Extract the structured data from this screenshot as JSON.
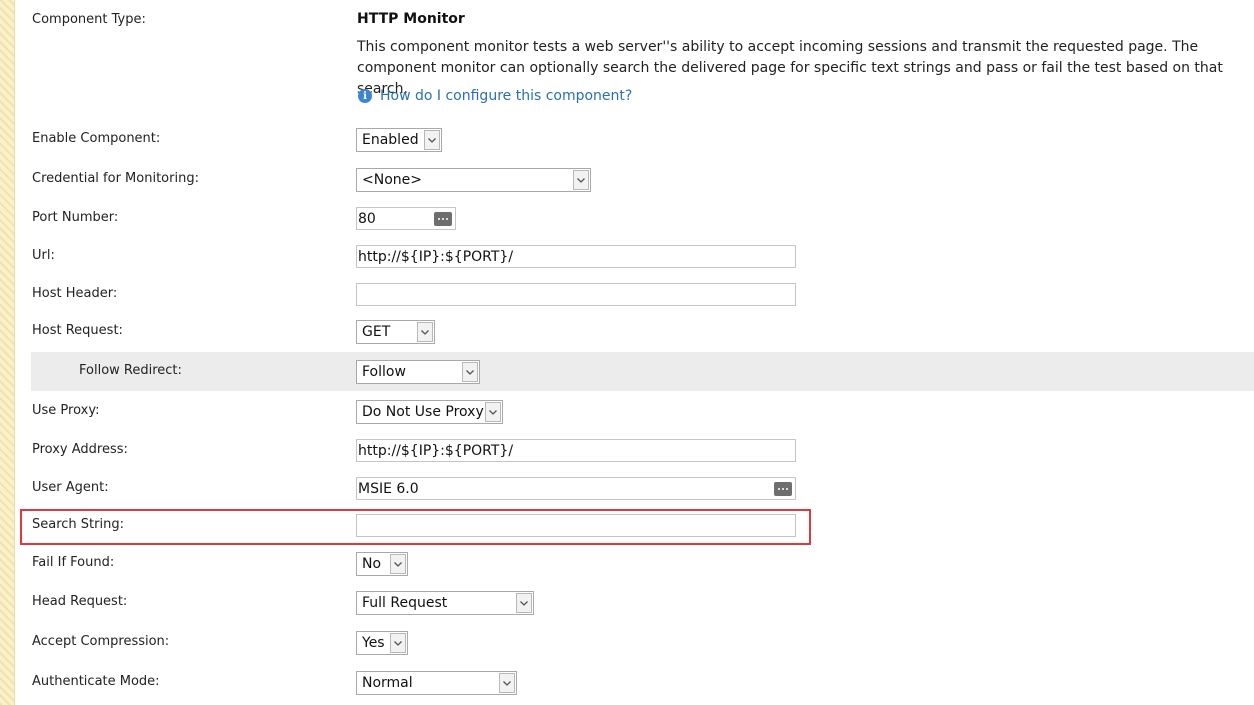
{
  "component": {
    "type_label": "Component Type:",
    "name": "HTTP Monitor",
    "description": "This component monitor tests a web server''s ability to accept incoming sessions and transmit the requested page. The component monitor can optionally search the delivered page for specific text strings and pass or fail the test based on that search.",
    "help_link": "How do I configure this component?",
    "help_icon": "info-icon"
  },
  "fields": {
    "enable_component": {
      "label": "Enable Component:",
      "value": "Enabled"
    },
    "credential": {
      "label": "Credential for Monitoring:",
      "value": "<None>"
    },
    "port": {
      "label": "Port Number:",
      "value": "80"
    },
    "url": {
      "label": "Url:",
      "value": "http://${IP}:${PORT}/"
    },
    "host_header": {
      "label": "Host Header:",
      "value": ""
    },
    "host_request": {
      "label": "Host Request:",
      "value": "GET"
    },
    "follow_redirect": {
      "label": "Follow Redirect:",
      "value": "Follow"
    },
    "use_proxy": {
      "label": "Use Proxy:",
      "value": "Do Not Use Proxy"
    },
    "proxy_address": {
      "label": "Proxy Address:",
      "value": "http://${IP}:${PORT}/"
    },
    "user_agent": {
      "label": "User Agent:",
      "value": "MSIE 6.0"
    },
    "search_string": {
      "label": "Search String:",
      "value": ""
    },
    "fail_if_found": {
      "label": "Fail If Found:",
      "value": "No"
    },
    "head_request": {
      "label": "Head Request:",
      "value": "Full Request"
    },
    "accept_compression": {
      "label": "Accept Compression:",
      "value": "Yes"
    },
    "authenticate_mode": {
      "label": "Authenticate Mode:",
      "value": "Normal"
    }
  },
  "colors": {
    "link": "#2a6fb3",
    "highlight_border": "#e0383c",
    "row_highlight": "#ececec",
    "sidebar_stripe": "#fbf1c8"
  }
}
